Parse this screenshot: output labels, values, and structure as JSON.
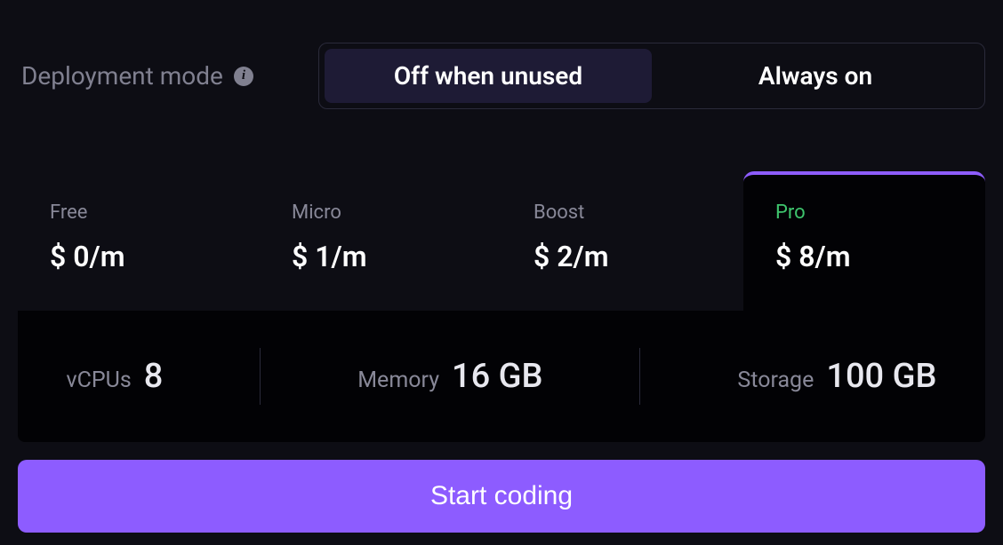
{
  "deployment": {
    "label": "Deployment mode",
    "options": [
      {
        "label": "Off when unused",
        "active": true
      },
      {
        "label": "Always on",
        "active": false
      }
    ]
  },
  "plans": [
    {
      "name": "Free",
      "price": "$ 0/m",
      "selected": false
    },
    {
      "name": "Micro",
      "price": "$ 1/m",
      "selected": false
    },
    {
      "name": "Boost",
      "price": "$ 2/m",
      "selected": false
    },
    {
      "name": "Pro",
      "price": "$ 8/m",
      "selected": true
    }
  ],
  "specs": {
    "vcpus": {
      "label": "vCPUs",
      "value": "8"
    },
    "memory": {
      "label": "Memory",
      "value": "16 GB"
    },
    "storage": {
      "label": "Storage",
      "value": "100 GB"
    }
  },
  "cta": {
    "label": "Start coding"
  }
}
